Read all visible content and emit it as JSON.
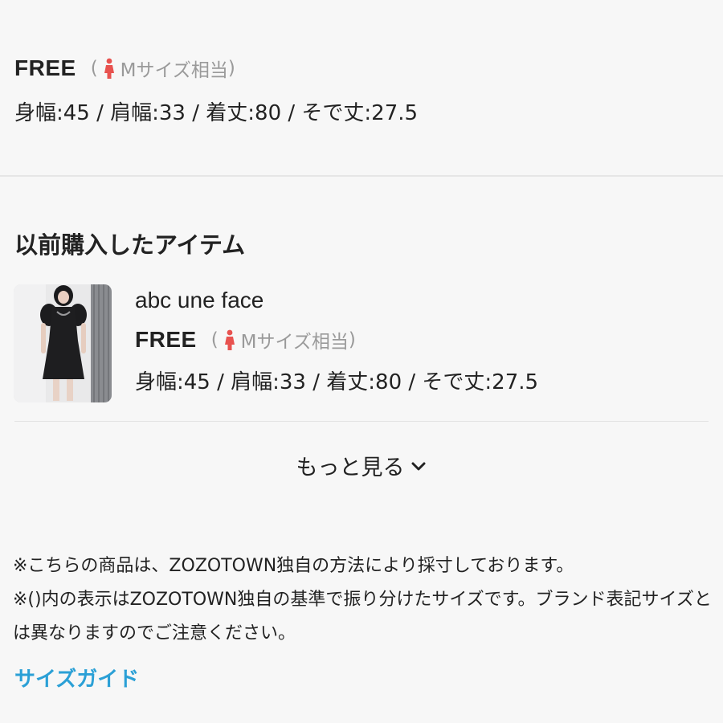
{
  "current_size": {
    "label": "FREE",
    "paren_open": "(",
    "equivalent": "Mサイズ相当",
    "paren_close": ")",
    "measurements": "身幅:45 / 肩幅:33 / 着丈:80 / そで丈:27.5"
  },
  "previous_purchases": {
    "title": "以前購入したアイテム",
    "items": [
      {
        "brand": "abc une face",
        "size_label": "FREE",
        "paren_open": "(",
        "equivalent": "Mサイズ相当",
        "paren_close": ")",
        "measurements": "身幅:45 / 肩幅:33 / 着丈:80 / そで丈:27.5"
      }
    ],
    "more_label": "もっと見る"
  },
  "notes": [
    "※こちらの商品は、ZOZOTOWN独自の方法により採寸しております。",
    "※()内の表示はZOZOTOWN独自の基準で振り分けたサイズです。ブランド表記サイズとは異なりますのでご注意ください。"
  ],
  "size_guide_link": "サイズガイド",
  "colors": {
    "accent_link": "#2ba0d6",
    "woman_icon": "#e8524f",
    "muted_text": "#9a9a9a",
    "background": "#f7f7f7"
  },
  "icons": {
    "woman": "woman-icon",
    "chevron": "chevron-down-icon"
  }
}
